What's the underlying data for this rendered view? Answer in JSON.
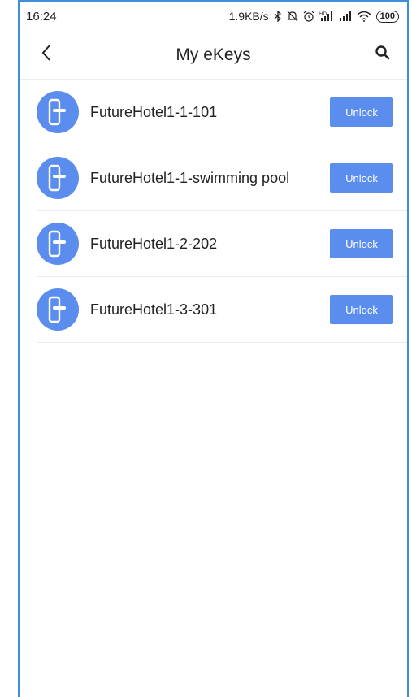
{
  "status_bar": {
    "time": "16:24",
    "network_speed": "1.9KB/s",
    "battery": "100",
    "icons": [
      "bluetooth-icon",
      "mute-icon",
      "alarm-icon",
      "hd-signal-icon",
      "signal-icon",
      "wifi-icon",
      "battery-icon"
    ]
  },
  "header": {
    "title": "My eKeys",
    "back_icon": "chevron-left-icon",
    "search_icon": "search-icon"
  },
  "colors": {
    "accent": "#5b8def",
    "frame": "#3f8fd8"
  },
  "ekeys": [
    {
      "name": "FutureHotel1-1-101",
      "action": "Unlock",
      "icon": "door-lock-icon"
    },
    {
      "name": "FutureHotel1-1-swimming pool",
      "action": "Unlock",
      "icon": "door-lock-icon"
    },
    {
      "name": "FutureHotel1-2-202",
      "action": "Unlock",
      "icon": "door-lock-icon"
    },
    {
      "name": "FutureHotel1-3-301",
      "action": "Unlock",
      "icon": "door-lock-icon"
    }
  ]
}
